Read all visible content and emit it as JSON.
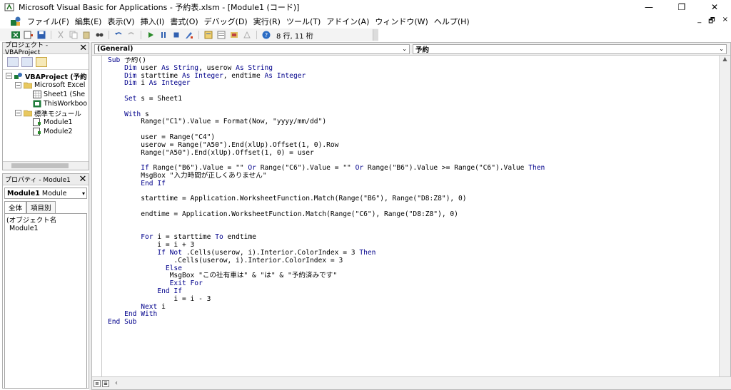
{
  "window": {
    "title": "Microsoft Visual Basic for Applications - 予約表.xlsm - [Module1 (コード)]",
    "minimize": "—",
    "maximize": "❐",
    "close": "✕"
  },
  "menu": {
    "items": [
      "ファイル(F)",
      "編集(E)",
      "表示(V)",
      "挿入(I)",
      "書式(O)",
      "デバッグ(D)",
      "実行(R)",
      "ツール(T)",
      "アドイン(A)",
      "ウィンドウ(W)",
      "ヘルプ(H)"
    ],
    "mdi_min": "_",
    "mdi_restore": "🗗",
    "mdi_close": "×"
  },
  "toolbar": {
    "status": "8 行, 11 桁"
  },
  "project_pane": {
    "title": "プロジェクト - VBAProject",
    "close": "✕",
    "tree": [
      {
        "label": "VBAProject (予約",
        "level": 0,
        "expand": "⊟",
        "icon": "vba-project-icon",
        "bold": true
      },
      {
        "label": "Microsoft Excel",
        "level": 1,
        "expand": "⊟",
        "icon": "folder-icon",
        "bold": false
      },
      {
        "label": "Sheet1 (She",
        "level": 2,
        "expand": "",
        "icon": "sheet-icon",
        "bold": false
      },
      {
        "label": "ThisWorkboo",
        "level": 2,
        "expand": "",
        "icon": "workbook-icon",
        "bold": false
      },
      {
        "label": "標準モジュール",
        "level": 1,
        "expand": "⊟",
        "icon": "folder-icon",
        "bold": false
      },
      {
        "label": "Module1",
        "level": 2,
        "expand": "",
        "icon": "module-icon",
        "bold": false
      },
      {
        "label": "Module2",
        "level": 2,
        "expand": "",
        "icon": "module-icon",
        "bold": false
      }
    ]
  },
  "props_pane": {
    "title": "プロパティ - Module1",
    "close": "✕",
    "object_name": "Module1",
    "object_type": "Module",
    "tabs": [
      "全体",
      "項目別"
    ],
    "row_name": "(オブジェクト名",
    "row_value": "Module1"
  },
  "code_window": {
    "object_combo": "(General)",
    "proc_combo": "予約",
    "lines": [
      [
        {
          "t": "Sub",
          "k": true
        },
        {
          "t": " 予約()"
        }
      ],
      [
        {
          "t": "    "
        },
        {
          "t": "Dim",
          "k": true
        },
        {
          "t": " user "
        },
        {
          "t": "As String",
          "k": true
        },
        {
          "t": ", userow "
        },
        {
          "t": "As String",
          "k": true
        }
      ],
      [
        {
          "t": "    "
        },
        {
          "t": "Dim",
          "k": true
        },
        {
          "t": " starttime "
        },
        {
          "t": "As Integer",
          "k": true
        },
        {
          "t": ", endtime "
        },
        {
          "t": "As Integer",
          "k": true
        }
      ],
      [
        {
          "t": "    "
        },
        {
          "t": "Dim",
          "k": true
        },
        {
          "t": " i "
        },
        {
          "t": "As Integer",
          "k": true
        }
      ],
      [
        {
          "t": ""
        }
      ],
      [
        {
          "t": "    "
        },
        {
          "t": "Set",
          "k": true
        },
        {
          "t": " s = Sheet1"
        }
      ],
      [
        {
          "t": ""
        }
      ],
      [
        {
          "t": "    "
        },
        {
          "t": "With",
          "k": true
        },
        {
          "t": " s"
        }
      ],
      [
        {
          "t": "        Range(\"C1\").Value = Format(Now, \"yyyy/mm/dd\")"
        }
      ],
      [
        {
          "t": ""
        }
      ],
      [
        {
          "t": "        user = Range(\"C4\")"
        }
      ],
      [
        {
          "t": "        userow = Range(\"A50\").End(xlUp).Offset(1, 0).Row"
        }
      ],
      [
        {
          "t": "        Range(\"A50\").End(xlUp).Offset(1, 0) = user"
        }
      ],
      [
        {
          "t": ""
        }
      ],
      [
        {
          "t": "        "
        },
        {
          "t": "If",
          "k": true
        },
        {
          "t": " Range(\"B6\").Value = \"\" "
        },
        {
          "t": "Or",
          "k": true
        },
        {
          "t": " Range(\"C6\").Value = \"\" "
        },
        {
          "t": "Or",
          "k": true
        },
        {
          "t": " Range(\"B6\").Value >= Range(\"C6\").Value "
        },
        {
          "t": "Then",
          "k": true
        }
      ],
      [
        {
          "t": "        MsgBox \"入力時間が正しくありません\""
        }
      ],
      [
        {
          "t": "        "
        },
        {
          "t": "End If",
          "k": true
        }
      ],
      [
        {
          "t": ""
        }
      ],
      [
        {
          "t": "        starttime = Application.WorksheetFunction.Match(Range(\"B6\"), Range(\"D8:Z8\"), 0)"
        }
      ],
      [
        {
          "t": ""
        }
      ],
      [
        {
          "t": "        endtime = Application.WorksheetFunction.Match(Range(\"C6\"), Range(\"D8:Z8\"), 0)"
        }
      ],
      [
        {
          "t": ""
        }
      ],
      [
        {
          "t": ""
        }
      ],
      [
        {
          "t": "        "
        },
        {
          "t": "For",
          "k": true
        },
        {
          "t": " i = starttime "
        },
        {
          "t": "To",
          "k": true
        },
        {
          "t": " endtime"
        }
      ],
      [
        {
          "t": "            i = i + 3"
        }
      ],
      [
        {
          "t": "            "
        },
        {
          "t": "If Not",
          "k": true
        },
        {
          "t": " .Cells(userow, i).Interior.ColorIndex = 3 "
        },
        {
          "t": "Then",
          "k": true
        }
      ],
      [
        {
          "t": "                .Cells(userow, i).Interior.ColorIndex = 3"
        }
      ],
      [
        {
          "t": "              "
        },
        {
          "t": "Else",
          "k": true
        }
      ],
      [
        {
          "t": "               MsgBox \"この社有車は\" & \"は\" & \"予約済みです\""
        }
      ],
      [
        {
          "t": "               "
        },
        {
          "t": "Exit For",
          "k": true
        }
      ],
      [
        {
          "t": "            "
        },
        {
          "t": "End If",
          "k": true
        }
      ],
      [
        {
          "t": "                i = i - 3"
        }
      ],
      [
        {
          "t": "        "
        },
        {
          "t": "Next",
          "k": true
        },
        {
          "t": " i"
        }
      ],
      [
        {
          "t": "    "
        },
        {
          "t": "End With",
          "k": true
        }
      ],
      [
        {
          "t": "End Sub",
          "k": true
        }
      ]
    ]
  },
  "colors": {
    "keyword": "#00008b",
    "accent": "#0078d7"
  }
}
